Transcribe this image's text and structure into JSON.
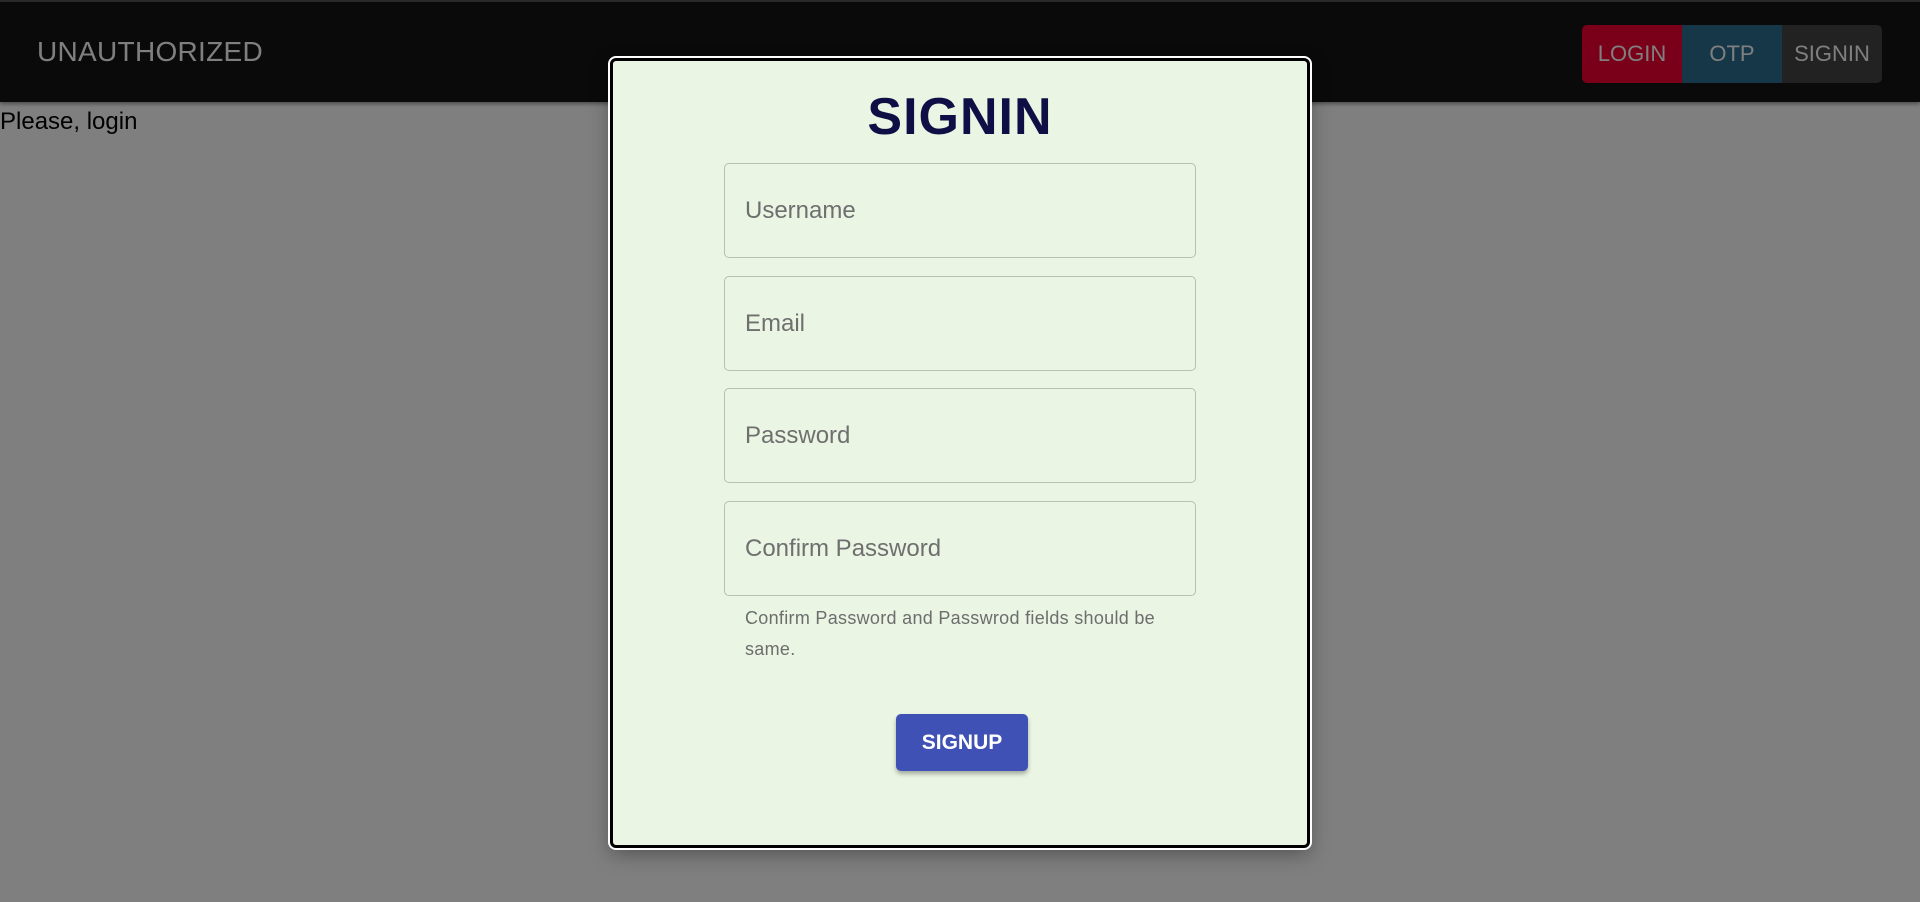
{
  "appbar": {
    "brand": "UNAUTHORIZED",
    "nav": [
      {
        "label": "LOGIN",
        "color": "#f50035"
      },
      {
        "label": "OTP",
        "color": "#2d6e8e"
      },
      {
        "label": "SIGNIN",
        "color": "#444444"
      }
    ]
  },
  "page": {
    "message": "Please, login"
  },
  "dialog": {
    "title": "SIGNIN",
    "fields": [
      {
        "placeholder": "Username",
        "value": ""
      },
      {
        "placeholder": "Email",
        "value": ""
      },
      {
        "placeholder": "Password",
        "value": ""
      },
      {
        "placeholder": "Confirm Password",
        "value": ""
      }
    ],
    "helper_text": "Confirm Password and Passwrod fields should be same.",
    "submit_label": "SIGNUP",
    "colors": {
      "background": "#eaf5e3",
      "title": "#0e0f45",
      "button": "#3f51b5"
    }
  }
}
